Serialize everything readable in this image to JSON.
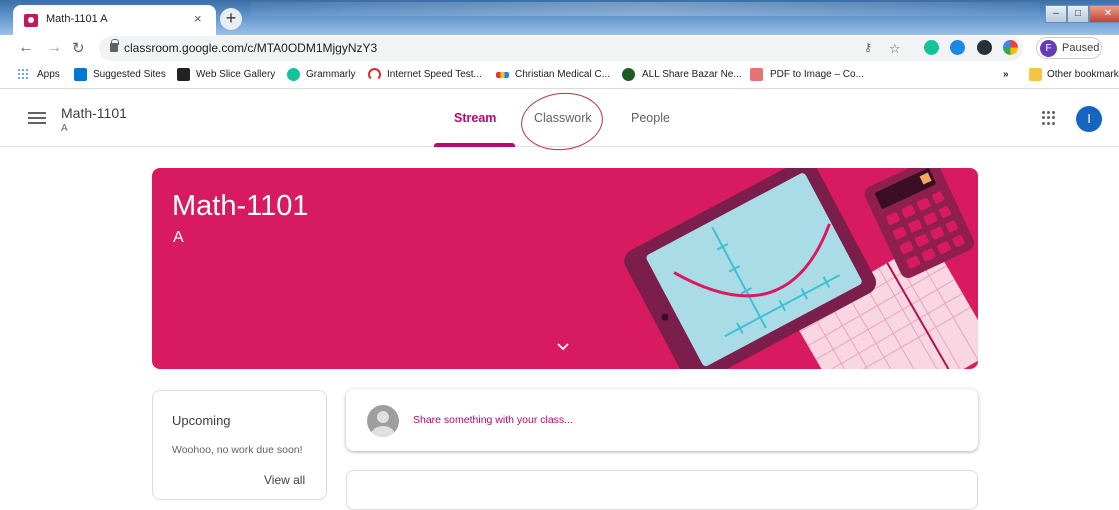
{
  "browser": {
    "tab_title": "Math-1101 A",
    "tab_close": "×",
    "new_tab": "+",
    "url": "classroom.google.com/c/MTA0ODM1MjgyNzY3",
    "profile_initial": "F",
    "profile_status": "Paused",
    "bookmarks": {
      "apps": "Apps",
      "suggested": "Suggested Sites",
      "webslice": "Web Slice Gallery",
      "grammarly": "Grammarly",
      "speedtest": "Internet Speed Test...",
      "christian": "Christian Medical C...",
      "sharebazar": "ALL Share Bazar Ne...",
      "pdf": "PDF to Image – Co...",
      "overflow": "»",
      "other": "Other bookmarks"
    },
    "icons": [
      "back-icon",
      "forward-icon",
      "reload-icon",
      "lock-icon",
      "key-icon",
      "star-icon",
      "grammarly-icon",
      "extension-icon",
      "menu-icon"
    ]
  },
  "app": {
    "class_name": "Math-1101",
    "section": "A",
    "tabs": [
      "Stream",
      "Classwork",
      "People"
    ],
    "active_tab": "Stream",
    "user_initial": "I",
    "accent_color": "#b80672"
  },
  "banner": {
    "title": "Math-1101",
    "section": "A",
    "color": "#d81b60"
  },
  "upcoming": {
    "title": "Upcoming",
    "empty_text": "Woohoo, no work due soon!",
    "view_all": "View all"
  },
  "stream": {
    "share_placeholder": "Share something with your class..."
  }
}
